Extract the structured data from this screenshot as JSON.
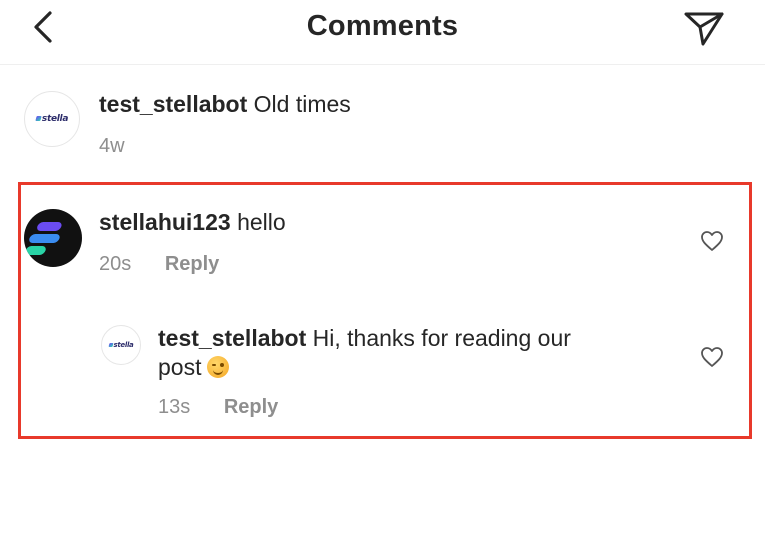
{
  "header": {
    "title": "Comments",
    "back_icon": "chevron-left-icon",
    "send_icon": "paper-plane-icon"
  },
  "comments": [
    {
      "username": "test_stellabot",
      "text": "Old times",
      "time": "4w",
      "avatar_logo": "stella"
    },
    {
      "username": "stellahui123",
      "text": "hello",
      "time": "20s",
      "reply_label": "Reply",
      "replies": [
        {
          "username": "test_stellabot",
          "text_line1": "Hi, thanks for reading our",
          "text_line2": "post",
          "emoji": "winking-face",
          "time": "13s",
          "reply_label": "Reply",
          "avatar_logo": "stella"
        }
      ]
    }
  ],
  "colors": {
    "highlight_border": "#e8392b",
    "meta_text": "#8e8e8e",
    "primary_text": "#262626"
  }
}
